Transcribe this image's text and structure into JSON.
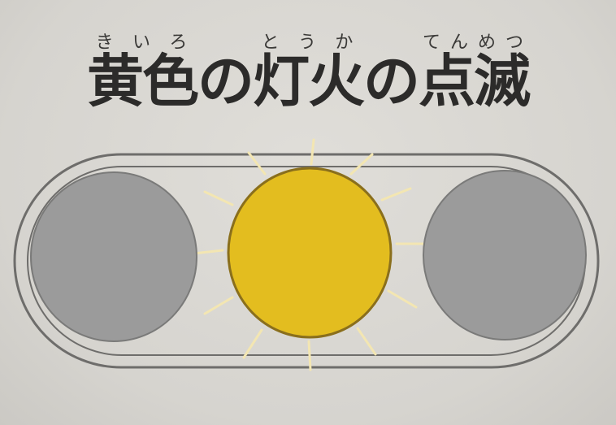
{
  "title": {
    "segments": [
      {
        "text": "黄色",
        "ruby": "きいろ"
      },
      {
        "text": "の",
        "ruby": ""
      },
      {
        "text": "灯火",
        "ruby": "とうか"
      },
      {
        "text": "の",
        "ruby": ""
      },
      {
        "text": "点滅",
        "ruby": "てんめつ"
      }
    ]
  },
  "signal": {
    "lights": [
      {
        "name": "left-light",
        "state": "off",
        "color": "#9b9b9b"
      },
      {
        "name": "center-light",
        "state": "flashing",
        "color": "#e3bd1f"
      },
      {
        "name": "right-light",
        "state": "off",
        "color": "#9b9b9b"
      }
    ],
    "housing_outline_color": "#6e6d6b",
    "ray_color": "#f3e6b2"
  }
}
